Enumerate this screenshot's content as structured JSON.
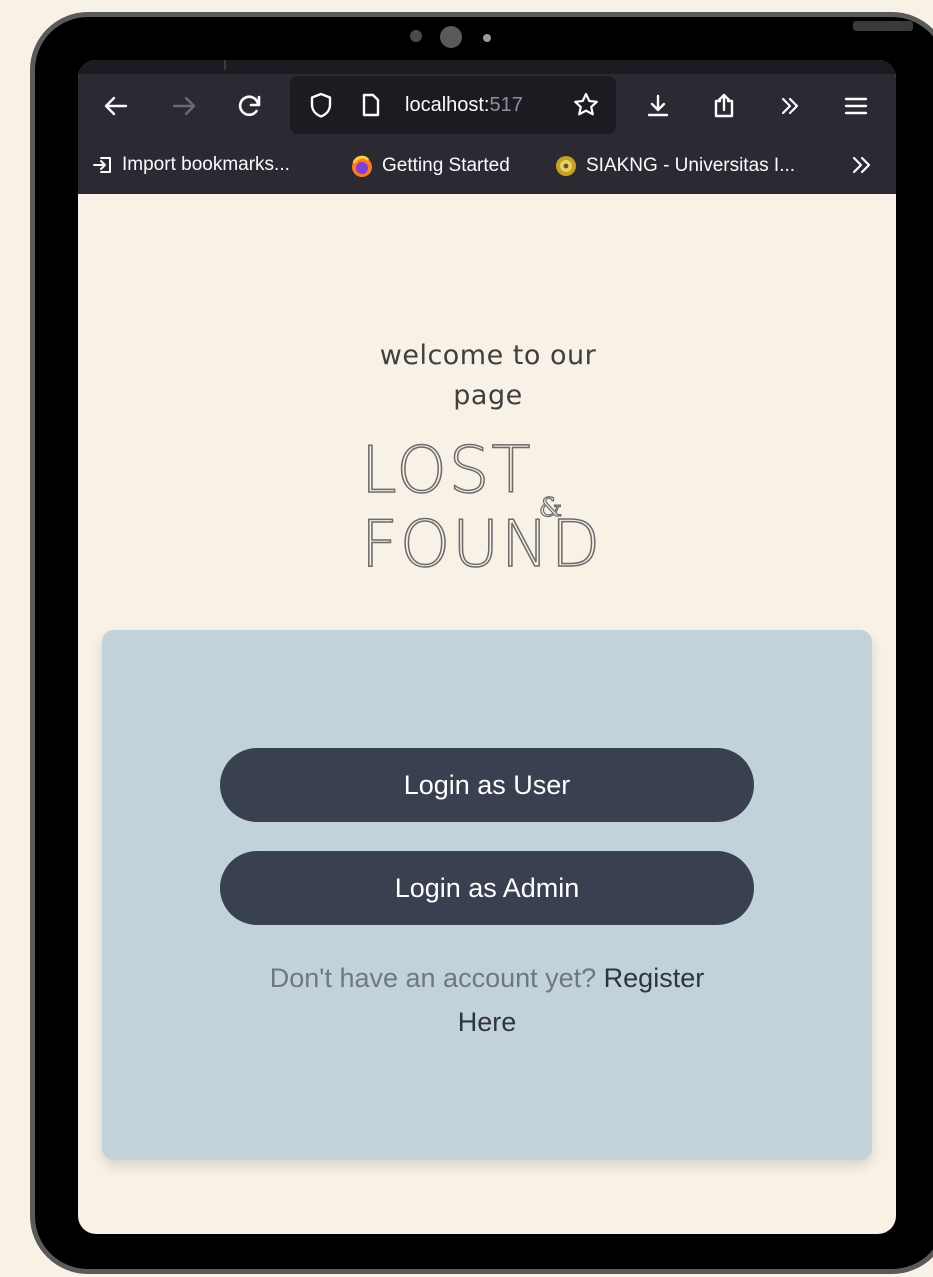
{
  "browser": {
    "url_host": "localhost:",
    "url_port_partial": "517",
    "bookmarks": [
      {
        "label": "Import bookmarks...",
        "icon": "import-icon"
      },
      {
        "label": "Getting Started",
        "icon": "firefox-icon"
      },
      {
        "label": "SIAKNG - Universitas I...",
        "icon": "siakng-icon"
      }
    ],
    "icons": {
      "back": "back-arrow-icon",
      "forward": "forward-arrow-icon",
      "reload": "reload-icon",
      "tracking": "shield-icon",
      "page": "page-icon",
      "bookmark_star": "star-icon",
      "downloads": "download-icon",
      "share": "share-icon",
      "overflow": "chevrons-right-icon",
      "menu": "hamburger-menu-icon"
    }
  },
  "page": {
    "welcome_line1": "welcome to our",
    "welcome_line2": "page",
    "logo": {
      "line1": "LOST",
      "ampersand": "&",
      "line2": "FOUND"
    }
  },
  "login_card": {
    "user_button": "Login as User",
    "admin_button": "Login as Admin",
    "register_prompt": "Don't have an account yet?",
    "register_link": "Register Here"
  },
  "colors": {
    "page_bg": "#f7f1e6",
    "card_bg": "#c1d3d8",
    "button_bg": "#394151",
    "button_text": "#ffffff",
    "chrome_bg": "#2b2a33"
  }
}
